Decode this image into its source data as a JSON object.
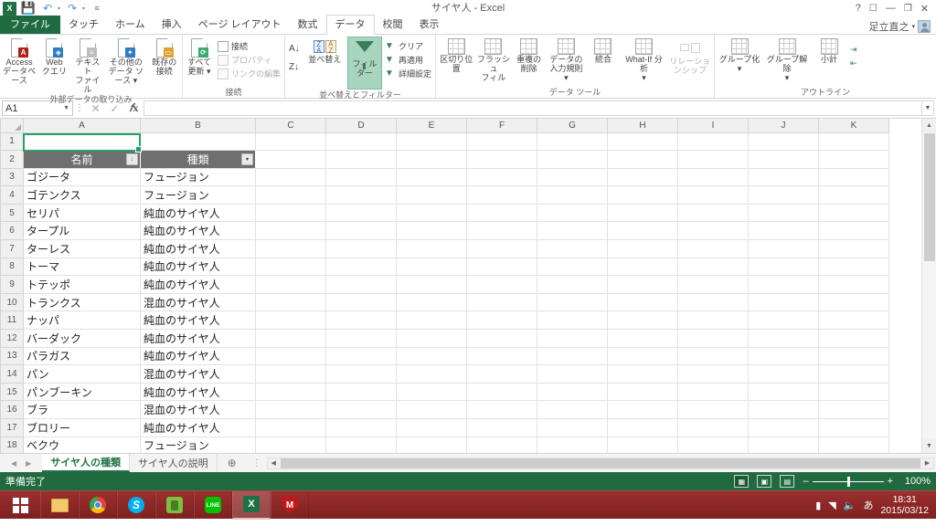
{
  "window": {
    "title": "サイヤ人 - Excel",
    "qat": [
      {
        "name": "excel-logo",
        "label": "X"
      },
      {
        "name": "save-icon",
        "label": "💾"
      },
      {
        "name": "undo-icon",
        "label": "↶"
      },
      {
        "name": "redo-icon",
        "label": "↷"
      },
      {
        "name": "qat-more-icon",
        "label": "≡"
      }
    ],
    "controls": [
      {
        "name": "help-button",
        "label": "?"
      },
      {
        "name": "ribbon-display-options-button",
        "label": "⬜"
      },
      {
        "name": "minimize-button",
        "label": "—"
      },
      {
        "name": "restore-button",
        "label": "❐"
      },
      {
        "name": "close-button",
        "label": "✕"
      }
    ],
    "account": {
      "name": "足立直之",
      "caret": "▾"
    }
  },
  "tabs": [
    {
      "label": "ファイル",
      "type": "file"
    },
    {
      "label": "タッチ",
      "type": "normal"
    },
    {
      "label": "ホーム",
      "type": "normal"
    },
    {
      "label": "挿入",
      "type": "normal"
    },
    {
      "label": "ページ レイアウト",
      "type": "normal"
    },
    {
      "label": "数式",
      "type": "normal"
    },
    {
      "label": "データ",
      "type": "active"
    },
    {
      "label": "校閲",
      "type": "normal"
    },
    {
      "label": "表示",
      "type": "normal"
    }
  ],
  "ribbon": {
    "groups": [
      {
        "title": "外部データの取り込み",
        "big": [
          {
            "label": "Access\nデータベース",
            "icon": "access-database-icon",
            "badge": "A",
            "badge_color": "#b32017"
          },
          {
            "label": "Web\nクエリ",
            "icon": "web-query-icon",
            "badge": "⊕",
            "badge_color": "#2d7dc4"
          },
          {
            "label": "テキスト\nファイル",
            "icon": "text-file-icon",
            "badge": "",
            "badge_color": ""
          },
          {
            "label": "その他の\nデータ ソース ▾",
            "icon": "other-data-sources-icon",
            "badge": "◈",
            "badge_color": "#2d7dc4"
          },
          {
            "label": "既存の\n接続",
            "icon": "existing-connections-icon",
            "badge": "",
            "badge_color": "#e0a030"
          }
        ]
      },
      {
        "title": "接続",
        "big": [
          {
            "label": "すべて\n更新 ▾",
            "icon": "refresh-all-icon",
            "badge": "",
            "badge_color": ""
          }
        ],
        "small": [
          {
            "label": "接続",
            "icon": "connections-icon",
            "dim": false
          },
          {
            "label": "プロパティ",
            "icon": "properties-icon",
            "dim": true
          },
          {
            "label": "リンクの編集",
            "icon": "edit-links-icon",
            "dim": true
          }
        ]
      },
      {
        "title": "並べ替えとフィルター",
        "sortbtns": [
          {
            "label": "A↓",
            "name": "sort-asc-icon"
          },
          {
            "label": "Z↓",
            "name": "sort-desc-icon"
          }
        ],
        "big": [
          {
            "label": "並べ替え",
            "icon": "sort-dialog-icon",
            "badge": "",
            "badge_color": ""
          },
          {
            "label": "フィルター",
            "icon": "filter-icon",
            "badge": "",
            "badge_color": "",
            "active": true
          }
        ],
        "small": [
          {
            "label": "クリア",
            "icon": "clear-filter-icon",
            "dim": false
          },
          {
            "label": "再適用",
            "icon": "reapply-filter-icon",
            "dim": false
          },
          {
            "label": "詳細設定",
            "icon": "advanced-filter-icon",
            "dim": false
          }
        ]
      },
      {
        "title": "データ ツール",
        "big": [
          {
            "label": "区切り位置",
            "icon": "text-to-columns-icon",
            "badge": "",
            "badge_color": ""
          },
          {
            "label": "フラッシュ\nフィル",
            "icon": "flash-fill-icon",
            "badge": "",
            "badge_color": ""
          },
          {
            "label": "重複の\n削除",
            "icon": "remove-duplicates-icon",
            "badge": "",
            "badge_color": ""
          },
          {
            "label": "データの\n入力規則 ▾",
            "icon": "data-validation-icon",
            "badge": "",
            "badge_color": ""
          },
          {
            "label": "統合",
            "icon": "consolidate-icon",
            "badge": "",
            "badge_color": ""
          },
          {
            "label": "What-If 分析\n▾",
            "icon": "what-if-analysis-icon",
            "badge": "",
            "badge_color": ""
          },
          {
            "label": "リレーションシップ",
            "icon": "relationships-icon",
            "badge": "",
            "badge_color": "",
            "dim": true
          }
        ]
      },
      {
        "title": "アウトライン",
        "big": [
          {
            "label": "グループ化\n▾",
            "icon": "group-icon",
            "badge": "",
            "badge_color": ""
          },
          {
            "label": "グループ解除\n▾",
            "icon": "ungroup-icon",
            "badge": "",
            "badge_color": ""
          },
          {
            "label": "小計",
            "icon": "subtotal-icon",
            "badge": "",
            "badge_color": ""
          }
        ],
        "small": [
          {
            "label": "",
            "icon": "show-detail-icon",
            "dim": false
          },
          {
            "label": "",
            "icon": "hide-detail-icon",
            "dim": false
          }
        ],
        "launcher": "⤵"
      }
    ]
  },
  "formula_bar": {
    "name_box": "A1",
    "cancel_icon": "✕",
    "enter_icon": "✓",
    "fx_icon": "fx",
    "value": "",
    "expand_caret": "▾"
  },
  "sheet": {
    "columns": [
      "A",
      "B",
      "C",
      "D",
      "E",
      "F",
      "G",
      "H",
      "I",
      "J",
      "K"
    ],
    "rows": [
      "1",
      "2",
      "3",
      "4",
      "5",
      "6",
      "7",
      "8",
      "9",
      "10",
      "11",
      "12",
      "13",
      "14",
      "15",
      "16",
      "17",
      "18"
    ],
    "header_row_index": 1,
    "headers": {
      "a": "名前",
      "b": "種類"
    },
    "filter_glyph_sorted": "↓",
    "filter_glyph": "▾",
    "data": [
      {
        "row": "3",
        "name": "ゴジータ",
        "kind": "フュージョン"
      },
      {
        "row": "4",
        "name": "ゴテンクス",
        "kind": "フュージョン"
      },
      {
        "row": "5",
        "name": "セリパ",
        "kind": "純血のサイヤ人"
      },
      {
        "row": "6",
        "name": "タープル",
        "kind": "純血のサイヤ人"
      },
      {
        "row": "7",
        "name": "ターレス",
        "kind": "純血のサイヤ人"
      },
      {
        "row": "8",
        "name": "トーマ",
        "kind": "純血のサイヤ人"
      },
      {
        "row": "9",
        "name": "トテッポ",
        "kind": "純血のサイヤ人"
      },
      {
        "row": "10",
        "name": "トランクス",
        "kind": "混血のサイヤ人"
      },
      {
        "row": "11",
        "name": "ナッパ",
        "kind": "純血のサイヤ人"
      },
      {
        "row": "12",
        "name": "バーダック",
        "kind": "純血のサイヤ人"
      },
      {
        "row": "13",
        "name": "パラガス",
        "kind": "純血のサイヤ人"
      },
      {
        "row": "14",
        "name": "パン",
        "kind": "混血のサイヤ人"
      },
      {
        "row": "15",
        "name": "パンブーキン",
        "kind": "純血のサイヤ人"
      },
      {
        "row": "16",
        "name": "ブラ",
        "kind": "混血のサイヤ人"
      },
      {
        "row": "17",
        "name": "ブロリー",
        "kind": "純血のサイヤ人"
      },
      {
        "row": "18",
        "name": "ベクウ",
        "kind": "フュージョン"
      }
    ],
    "selected_cell": "A1"
  },
  "sheet_tabs": {
    "prev_icon": "◀",
    "next_icon": "▶",
    "items": [
      {
        "label": "サイヤ人の種類",
        "active": true
      },
      {
        "label": "サイヤ人の説明",
        "active": false
      }
    ],
    "new_sheet_icon": "⊕"
  },
  "status_bar": {
    "status": "準備完了",
    "views": [
      {
        "name": "normal-view-button",
        "label": "⌗",
        "active": true
      },
      {
        "name": "page-layout-view-button",
        "label": "⌸",
        "active": false
      },
      {
        "name": "page-break-preview-button",
        "label": "▤",
        "active": false
      }
    ],
    "zoom_out": "–",
    "zoom_in": "+",
    "zoom": "100%"
  },
  "taskbar": {
    "start_label": "⊞",
    "apps": [
      {
        "name": "file-explorer-icon",
        "glyph": "📁",
        "color": "#f0c14b",
        "active": false
      },
      {
        "name": "chrome-icon",
        "glyph": "",
        "color": "#4285f4",
        "active": false
      },
      {
        "name": "skype-icon",
        "glyph": "S",
        "color": "#00aff0",
        "active": false
      },
      {
        "name": "evernote-icon",
        "glyph": "",
        "color": "#7ac142",
        "active": false
      },
      {
        "name": "line-icon",
        "glyph": "LINE",
        "color": "#00c300",
        "active": false
      },
      {
        "name": "excel-taskbar-icon",
        "glyph": "X",
        "color": "#1e7145",
        "active": true
      },
      {
        "name": "mcafee-icon",
        "glyph": "M",
        "color": "#c01818",
        "active": false
      }
    ],
    "tray": [
      {
        "name": "battery-icon",
        "glyph": "▮"
      },
      {
        "name": "network-icon",
        "glyph": "◢"
      },
      {
        "name": "volume-icon",
        "glyph": "🔊"
      },
      {
        "name": "ime-icon",
        "glyph": "あ"
      }
    ],
    "time": "18:31",
    "date": "2015/03/12"
  }
}
